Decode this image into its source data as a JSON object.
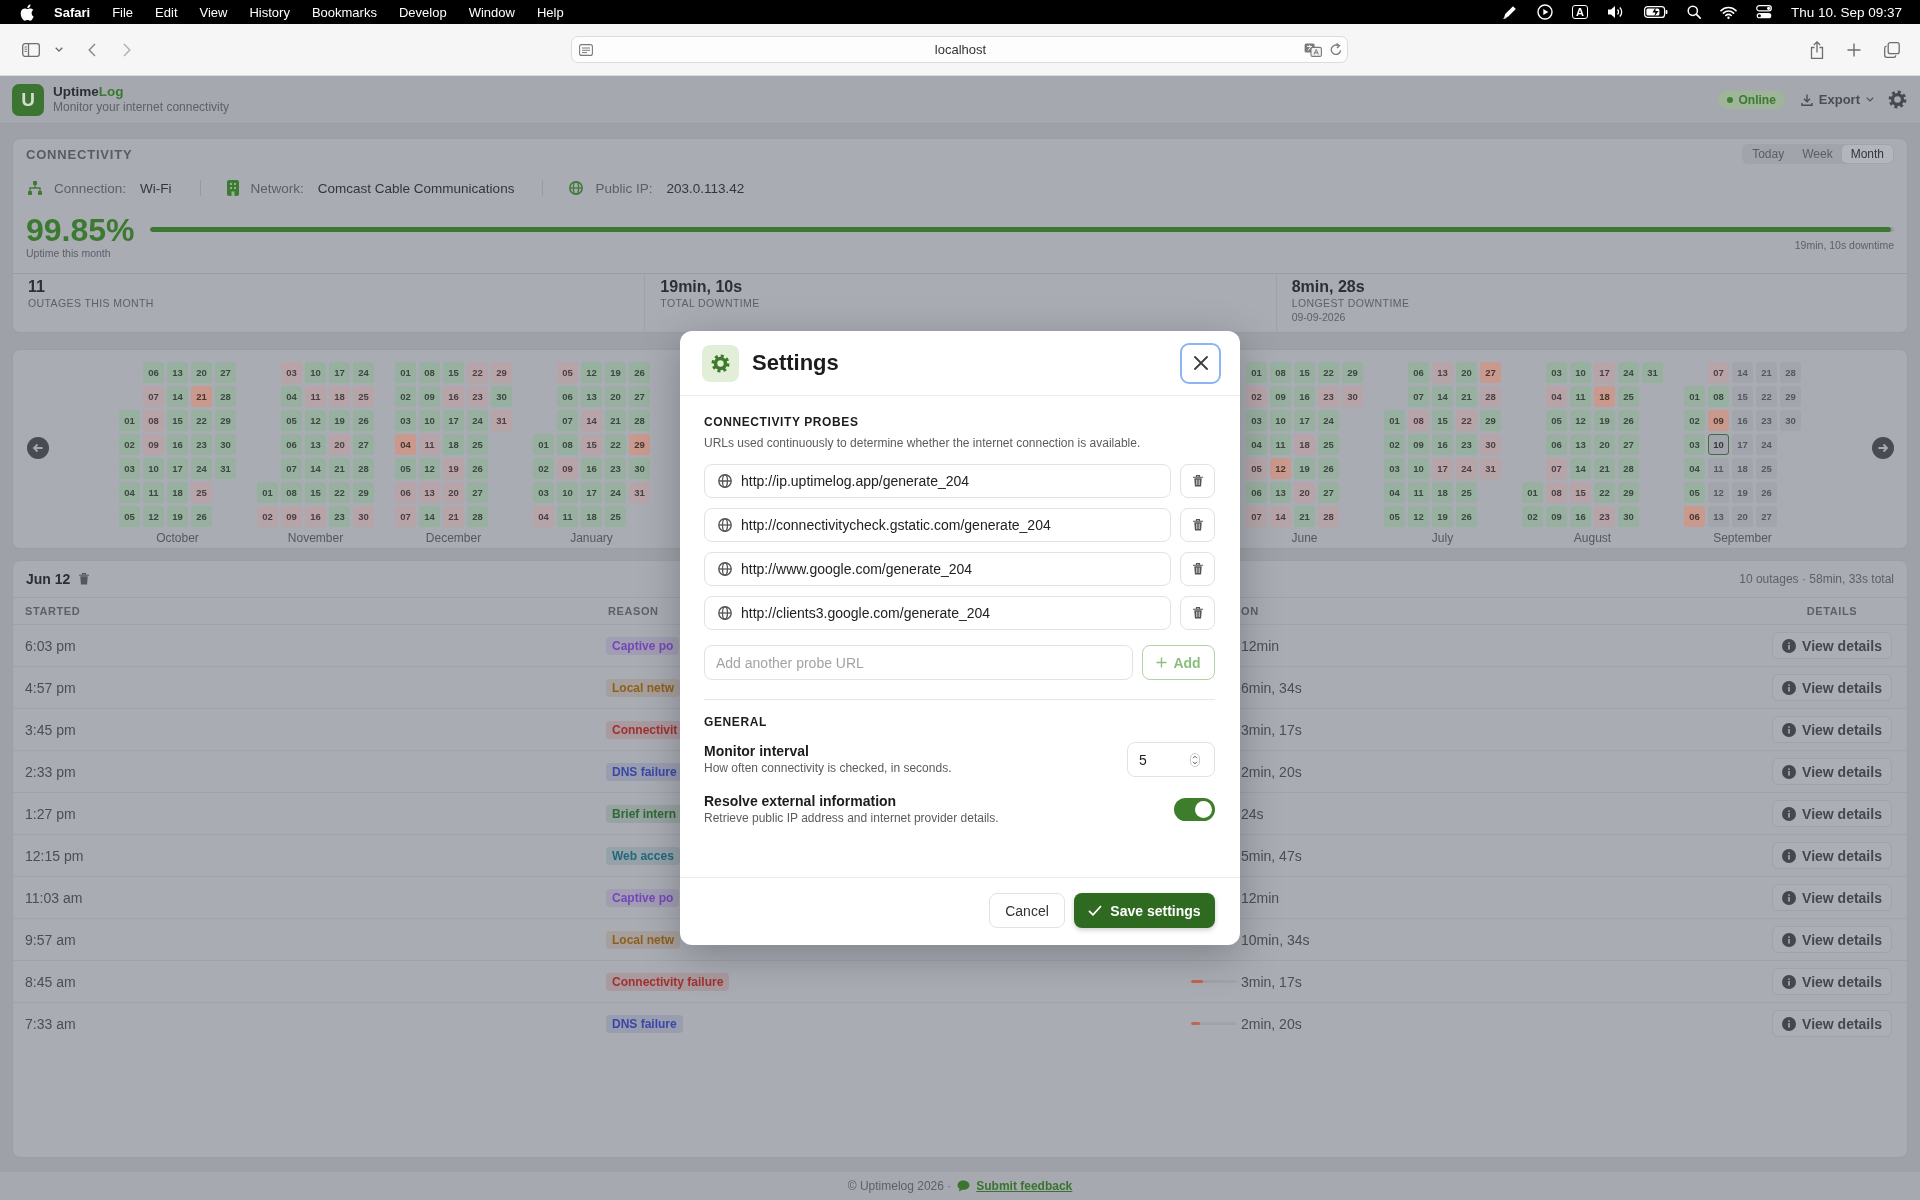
{
  "menubar": {
    "app": "Safari",
    "menus": [
      "File",
      "Edit",
      "View",
      "History",
      "Bookmarks",
      "Develop",
      "Window",
      "Help"
    ],
    "input_source": "A",
    "clock": "Thu 10. Sep 09:37"
  },
  "browser": {
    "address": "localhost"
  },
  "header": {
    "logo_letter": "U",
    "title": "Uptime",
    "title_accent": "Log",
    "tagline": "Monitor your internet connectivity",
    "status": "Online",
    "export": "Export"
  },
  "connectivity": {
    "title": "CONNECTIVITY",
    "ranges": [
      {
        "label": "Today",
        "selected": false
      },
      {
        "label": "Week",
        "selected": false
      },
      {
        "label": "Month",
        "selected": true
      }
    ],
    "facts": [
      {
        "kind": "connection",
        "label": "Connection:",
        "value": "Wi-Fi"
      },
      {
        "kind": "network",
        "label": "Network:",
        "value": "Comcast Cable Communications"
      },
      {
        "kind": "ip",
        "label": "Public IP:",
        "value": "203.0.113.42"
      }
    ],
    "uptime": "99.85%",
    "uptime_label": "Uptime this month",
    "uptime_bar": {
      "level": 0.9985
    },
    "downtime_note": "19min, 10s downtime",
    "stats": [
      {
        "value": "11",
        "label": "OUTAGES THIS MONTH"
      },
      {
        "value": "19min, 10s",
        "label": "TOTAL DOWNTIME"
      },
      {
        "value": "8min, 28s",
        "label": "LONGEST DOWNTIME",
        "note": "09-09-2026"
      }
    ]
  },
  "calendar": {
    "months_left": [
      {
        "name": "October",
        "weeks": [
          [
            {
              "day": "01",
              "kind": "up"
            },
            {
              "day": "02",
              "kind": "up"
            },
            {
              "day": "03",
              "kind": "up"
            },
            {
              "day": "04",
              "kind": "up"
            },
            {
              "day": "05",
              "kind": "up"
            }
          ],
          [
            {
              "day": "06",
              "kind": "up"
            },
            {
              "day": "07",
              "kind": "minor"
            },
            {
              "day": "08",
              "kind": "minor"
            },
            {
              "day": "09",
              "kind": "minor"
            },
            {
              "day": "10",
              "kind": "up"
            },
            {
              "day": "11",
              "kind": "up"
            },
            {
              "day": "12",
              "kind": "up"
            }
          ],
          [
            {
              "day": "13",
              "kind": "up"
            },
            {
              "day": "14",
              "kind": "up"
            },
            {
              "day": "15",
              "kind": "up"
            },
            {
              "day": "16",
              "kind": "up"
            },
            {
              "day": "17",
              "kind": "up"
            },
            {
              "day": "18",
              "kind": "up"
            },
            {
              "day": "19",
              "kind": "up"
            }
          ],
          [
            {
              "day": "20",
              "kind": "up"
            },
            {
              "day": "21",
              "kind": "major"
            },
            {
              "day": "22",
              "kind": "up"
            },
            {
              "day": "23",
              "kind": "up"
            },
            {
              "day": "24",
              "kind": "up"
            },
            {
              "day": "25",
              "kind": "minor"
            },
            {
              "day": "26",
              "kind": "up"
            }
          ],
          [
            {
              "day": "27",
              "kind": "up"
            },
            {
              "day": "28",
              "kind": "up"
            },
            {
              "day": "29",
              "kind": "up"
            },
            {
              "day": "30",
              "kind": "up"
            },
            {
              "day": "31",
              "kind": "up"
            }
          ]
        ]
      },
      {
        "name": "November",
        "weeks": [
          [
            {
              "day": "01",
              "kind": "up"
            },
            {
              "day": "02",
              "kind": "minor"
            }
          ],
          [
            {
              "day": "03",
              "kind": "minor"
            },
            {
              "day": "04",
              "kind": "up"
            },
            {
              "day": "05",
              "kind": "up"
            },
            {
              "day": "06",
              "kind": "up"
            },
            {
              "day": "07",
              "kind": "up"
            },
            {
              "day": "08",
              "kind": "up"
            },
            {
              "day": "09",
              "kind": "minor"
            }
          ],
          [
            {
              "day": "10",
              "kind": "up"
            },
            {
              "day": "11",
              "kind": "minor"
            },
            {
              "day": "12",
              "kind": "up"
            },
            {
              "day": "13",
              "kind": "up"
            },
            {
              "day": "14",
              "kind": "up"
            },
            {
              "day": "15",
              "kind": "up"
            },
            {
              "day": "16",
              "kind": "minor"
            }
          ],
          [
            {
              "day": "17",
              "kind": "up"
            },
            {
              "day": "18",
              "kind": "minor"
            },
            {
              "day": "19",
              "kind": "up"
            },
            {
              "day": "20",
              "kind": "minor"
            },
            {
              "day": "21",
              "kind": "up"
            },
            {
              "day": "22",
              "kind": "up"
            },
            {
              "day": "23",
              "kind": "up"
            }
          ],
          [
            {
              "day": "24",
              "kind": "up"
            },
            {
              "day": "25",
              "kind": "minor"
            },
            {
              "day": "26",
              "kind": "up"
            },
            {
              "day": "27",
              "kind": "up"
            },
            {
              "day": "28",
              "kind": "up"
            },
            {
              "day": "29",
              "kind": "up"
            },
            {
              "day": "30",
              "kind": "minor"
            }
          ]
        ]
      },
      {
        "name": "December",
        "weeks": [
          [
            {
              "day": "01",
              "kind": "up"
            },
            {
              "day": "02",
              "kind": "up"
            },
            {
              "day": "03",
              "kind": "up"
            },
            {
              "day": "04",
              "kind": "major"
            },
            {
              "day": "05",
              "kind": "up"
            },
            {
              "day": "06",
              "kind": "minor"
            },
            {
              "day": "07",
              "kind": "minor"
            }
          ],
          [
            {
              "day": "08",
              "kind": "up"
            },
            {
              "day": "09",
              "kind": "up"
            },
            {
              "day": "10",
              "kind": "up"
            },
            {
              "day": "11",
              "kind": "minor"
            },
            {
              "day": "12",
              "kind": "up"
            },
            {
              "day": "13",
              "kind": "minor"
            },
            {
              "day": "14",
              "kind": "up"
            }
          ],
          [
            {
              "day": "15",
              "kind": "up"
            },
            {
              "day": "16",
              "kind": "minor"
            },
            {
              "day": "17",
              "kind": "up"
            },
            {
              "day": "18",
              "kind": "up"
            },
            {
              "day": "19",
              "kind": "minor"
            },
            {
              "day": "20",
              "kind": "minor"
            },
            {
              "day": "21",
              "kind": "minor"
            }
          ],
          [
            {
              "day": "22",
              "kind": "minor"
            },
            {
              "day": "23",
              "kind": "minor"
            },
            {
              "day": "24",
              "kind": "up"
            },
            {
              "day": "25",
              "kind": "up"
            },
            {
              "day": "26",
              "kind": "up"
            },
            {
              "day": "27",
              "kind": "up"
            },
            {
              "day": "28",
              "kind": "up"
            }
          ],
          [
            {
              "day": "29",
              "kind": "minor"
            },
            {
              "day": "30",
              "kind": "up"
            },
            {
              "day": "31",
              "kind": "minor"
            }
          ]
        ]
      },
      {
        "name": "January",
        "weeks": [
          [
            {
              "day": "01",
              "kind": "up"
            },
            {
              "day": "02",
              "kind": "up"
            },
            {
              "day": "03",
              "kind": "up"
            },
            {
              "day": "04",
              "kind": "minor"
            }
          ],
          [
            {
              "day": "05",
              "kind": "minor"
            },
            {
              "day": "06",
              "kind": "up"
            },
            {
              "day": "07",
              "kind": "up"
            },
            {
              "day": "08",
              "kind": "up"
            },
            {
              "day": "09",
              "kind": "minor"
            },
            {
              "day": "10",
              "kind": "up"
            },
            {
              "day": "11",
              "kind": "up"
            }
          ],
          [
            {
              "day": "12",
              "kind": "up"
            },
            {
              "day": "13",
              "kind": "up"
            },
            {
              "day": "14",
              "kind": "minor"
            },
            {
              "day": "15",
              "kind": "minor"
            },
            {
              "day": "16",
              "kind": "up"
            },
            {
              "day": "17",
              "kind": "up"
            },
            {
              "day": "18",
              "kind": "up"
            }
          ],
          [
            {
              "day": "19",
              "kind": "up"
            },
            {
              "day": "20",
              "kind": "up"
            },
            {
              "day": "21",
              "kind": "up"
            },
            {
              "day": "22",
              "kind": "up"
            },
            {
              "day": "23",
              "kind": "up"
            },
            {
              "day": "24",
              "kind": "up"
            },
            {
              "day": "25",
              "kind": "up"
            }
          ],
          [
            {
              "day": "26",
              "kind": "up"
            },
            {
              "day": "27",
              "kind": "up"
            },
            {
              "day": "28",
              "kind": "up"
            },
            {
              "day": "29",
              "kind": "major"
            },
            {
              "day": "30",
              "kind": "up"
            },
            {
              "day": "31",
              "kind": "minor"
            }
          ]
        ]
      }
    ],
    "months_right": [
      {
        "name": "June",
        "weeks": [
          [
            {
              "day": "01",
              "kind": "up"
            },
            {
              "day": "02",
              "kind": "minor"
            },
            {
              "day": "03",
              "kind": "up"
            },
            {
              "day": "04",
              "kind": "up"
            },
            {
              "day": "05",
              "kind": "minor"
            },
            {
              "day": "06",
              "kind": "up"
            },
            {
              "day": "07",
              "kind": "minor"
            }
          ],
          [
            {
              "day": "08",
              "kind": "up"
            },
            {
              "day": "09",
              "kind": "up"
            },
            {
              "day": "10",
              "kind": "up"
            },
            {
              "day": "11",
              "kind": "up"
            },
            {
              "day": "12",
              "kind": "major"
            },
            {
              "day": "13",
              "kind": "up"
            },
            {
              "day": "14",
              "kind": "minor"
            }
          ],
          [
            {
              "day": "15",
              "kind": "up"
            },
            {
              "day": "16",
              "kind": "up"
            },
            {
              "day": "17",
              "kind": "up"
            },
            {
              "day": "18",
              "kind": "minor"
            },
            {
              "day": "19",
              "kind": "up"
            },
            {
              "day": "20",
              "kind": "minor"
            },
            {
              "day": "21",
              "kind": "up"
            }
          ],
          [
            {
              "day": "22",
              "kind": "up"
            },
            {
              "day": "23",
              "kind": "minor"
            },
            {
              "day": "24",
              "kind": "up"
            },
            {
              "day": "25",
              "kind": "up"
            },
            {
              "day": "26",
              "kind": "up"
            },
            {
              "day": "27",
              "kind": "up"
            },
            {
              "day": "28",
              "kind": "minor"
            }
          ],
          [
            {
              "day": "29",
              "kind": "up"
            },
            {
              "day": "30",
              "kind": "minor"
            }
          ]
        ]
      },
      {
        "name": "July",
        "weeks": [
          [
            {
              "day": "01",
              "kind": "up"
            },
            {
              "day": "02",
              "kind": "up"
            },
            {
              "day": "03",
              "kind": "up"
            },
            {
              "day": "04",
              "kind": "up"
            },
            {
              "day": "05",
              "kind": "up"
            }
          ],
          [
            {
              "day": "06",
              "kind": "up"
            },
            {
              "day": "07",
              "kind": "up"
            },
            {
              "day": "08",
              "kind": "minor"
            },
            {
              "day": "09",
              "kind": "up"
            },
            {
              "day": "10",
              "kind": "up"
            },
            {
              "day": "11",
              "kind": "up"
            },
            {
              "day": "12",
              "kind": "up"
            }
          ],
          [
            {
              "day": "13",
              "kind": "minor"
            },
            {
              "day": "14",
              "kind": "up"
            },
            {
              "day": "15",
              "kind": "up"
            },
            {
              "day": "16",
              "kind": "up"
            },
            {
              "day": "17",
              "kind": "minor"
            },
            {
              "day": "18",
              "kind": "up"
            },
            {
              "day": "19",
              "kind": "up"
            }
          ],
          [
            {
              "day": "20",
              "kind": "up"
            },
            {
              "day": "21",
              "kind": "up"
            },
            {
              "day": "22",
              "kind": "minor"
            },
            {
              "day": "23",
              "kind": "up"
            },
            {
              "day": "24",
              "kind": "minor"
            },
            {
              "day": "25",
              "kind": "up"
            },
            {
              "day": "26",
              "kind": "up"
            }
          ],
          [
            {
              "day": "27",
              "kind": "major"
            },
            {
              "day": "28",
              "kind": "minor"
            },
            {
              "day": "29",
              "kind": "up"
            },
            {
              "day": "30",
              "kind": "minor"
            },
            {
              "day": "31",
              "kind": "minor"
            }
          ]
        ]
      },
      {
        "name": "August",
        "weeks": [
          [
            {
              "day": "01",
              "kind": "up"
            },
            {
              "day": "02",
              "kind": "up"
            }
          ],
          [
            {
              "day": "03",
              "kind": "up"
            },
            {
              "day": "04",
              "kind": "minor"
            },
            {
              "day": "05",
              "kind": "up"
            },
            {
              "day": "06",
              "kind": "up"
            },
            {
              "day": "07",
              "kind": "minor"
            },
            {
              "day": "08",
              "kind": "minor"
            },
            {
              "day": "09",
              "kind": "up"
            }
          ],
          [
            {
              "day": "10",
              "kind": "up"
            },
            {
              "day": "11",
              "kind": "up"
            },
            {
              "day": "12",
              "kind": "up"
            },
            {
              "day": "13",
              "kind": "up"
            },
            {
              "day": "14",
              "kind": "up"
            },
            {
              "day": "15",
              "kind": "minor"
            },
            {
              "day": "16",
              "kind": "up"
            }
          ],
          [
            {
              "day": "17",
              "kind": "minor"
            },
            {
              "day": "18",
              "kind": "major"
            },
            {
              "day": "19",
              "kind": "up"
            },
            {
              "day": "20",
              "kind": "up"
            },
            {
              "day": "21",
              "kind": "up"
            },
            {
              "day": "22",
              "kind": "up"
            },
            {
              "day": "23",
              "kind": "minor"
            }
          ],
          [
            {
              "day": "24",
              "kind": "up"
            },
            {
              "day": "25",
              "kind": "up"
            },
            {
              "day": "26",
              "kind": "up"
            },
            {
              "day": "27",
              "kind": "up"
            },
            {
              "day": "28",
              "kind": "up"
            },
            {
              "day": "29",
              "kind": "up"
            },
            {
              "day": "30",
              "kind": "up"
            }
          ],
          [
            {
              "day": "31",
              "kind": "up"
            }
          ]
        ]
      },
      {
        "name": "September",
        "weeks": [
          [
            {
              "day": "01",
              "kind": "up"
            },
            {
              "day": "02",
              "kind": "up"
            },
            {
              "day": "03",
              "kind": "up"
            },
            {
              "day": "04",
              "kind": "up"
            },
            {
              "day": "05",
              "kind": "up"
            },
            {
              "day": "06",
              "kind": "major"
            }
          ],
          [
            {
              "day": "07",
              "kind": "minor"
            },
            {
              "day": "08",
              "kind": "up"
            },
            {
              "day": "09",
              "kind": "major"
            },
            {
              "day": "10",
              "kind": "today"
            },
            {
              "day": "11",
              "kind": "future"
            },
            {
              "day": "12",
              "kind": "future"
            },
            {
              "day": "13",
              "kind": "future"
            }
          ],
          [
            {
              "day": "14",
              "kind": "future"
            },
            {
              "day": "15",
              "kind": "future"
            },
            {
              "day": "16",
              "kind": "future"
            },
            {
              "day": "17",
              "kind": "future"
            },
            {
              "day": "18",
              "kind": "future"
            },
            {
              "day": "19",
              "kind": "future"
            },
            {
              "day": "20",
              "kind": "future"
            }
          ],
          [
            {
              "day": "21",
              "kind": "future"
            },
            {
              "day": "22",
              "kind": "future"
            },
            {
              "day": "23",
              "kind": "future"
            },
            {
              "day": "24",
              "kind": "future"
            },
            {
              "day": "25",
              "kind": "future"
            },
            {
              "day": "26",
              "kind": "future"
            },
            {
              "day": "27",
              "kind": "future"
            }
          ],
          [
            {
              "day": "28",
              "kind": "future"
            },
            {
              "day": "29",
              "kind": "future"
            },
            {
              "day": "30",
              "kind": "future"
            }
          ]
        ]
      }
    ]
  },
  "outages": {
    "date": "Jun 12",
    "summary": "10 outages · 58min, 33s total",
    "columns": [
      {
        "kind": "started",
        "label": "STARTED"
      },
      {
        "kind": "reason",
        "label": "REASON"
      },
      {
        "kind": "duration",
        "label": "ON"
      },
      {
        "kind": "details",
        "label": "DETAILS"
      }
    ],
    "rows": [
      {
        "started": "6:03 pm",
        "reason": "Captive po",
        "color": "#7447b8",
        "duration": "12min",
        "details": "View details"
      },
      {
        "started": "4:57 pm",
        "reason": "Local netw",
        "color": "#8f5f1c",
        "duration": "6min, 34s",
        "details": "View details"
      },
      {
        "started": "3:45 pm",
        "reason": "Connectivit",
        "color": "#a3302e",
        "duration": "3min, 17s",
        "details": "View details"
      },
      {
        "started": "2:33 pm",
        "reason": "DNS failure",
        "color": "#3b47a6",
        "duration": "2min, 20s",
        "details": "View details"
      },
      {
        "started": "1:27 pm",
        "reason": "Brief intern",
        "color": "#2c6b36",
        "duration": "24s",
        "details": "View details"
      },
      {
        "started": "12:15 pm",
        "reason": "Web acces",
        "color": "#22697a",
        "duration": "5min, 47s",
        "details": "View details"
      },
      {
        "started": "11:03 am",
        "reason": "Captive po",
        "color": "#7447b8",
        "duration": "12min",
        "details": "View details"
      },
      {
        "started": "9:57 am",
        "reason": "Local netw",
        "color": "#8f5f1c",
        "duration": "10min, 34s",
        "details": "View details"
      },
      {
        "started": "8:45 am",
        "reason": "Connectivity failure",
        "color": "#a3302e",
        "level": 0.27,
        "duration": "3min, 17s",
        "details": "View details"
      },
      {
        "started": "7:33 am",
        "reason": "DNS failure",
        "color": "#3b47a6",
        "level": 0.19,
        "duration": "2min, 20s",
        "details": "View details"
      }
    ]
  },
  "footer": {
    "copyright": "© Uptimelog 2026 ·",
    "link": "Submit feedback"
  },
  "settings": {
    "title": "Settings",
    "probes_title": "CONNECTIVITY PROBES",
    "probes_description": "URLs used continuously to determine whether the internet connection is available.",
    "probes": [
      "http://ip.uptimelog.app/generate_204",
      "http://connectivitycheck.gstatic.com/generate_204",
      "http://www.google.com/generate_204",
      "http://clients3.google.com/generate_204"
    ],
    "new_probe": {
      "placeholder": "Add another probe URL"
    },
    "add_button": {
      "label": "Add",
      "disabled": true
    },
    "general_title": "GENERAL",
    "options": [
      {
        "kind": "number",
        "label": "Monitor interval",
        "description": "How often connectivity is checked, in seconds.",
        "value": "5"
      },
      {
        "kind": "toggle",
        "label": "Resolve external information",
        "description": "Retrieve public IP address and internet provider details.",
        "on": true
      }
    ],
    "cancel": "Cancel",
    "save": "Save settings"
  }
}
